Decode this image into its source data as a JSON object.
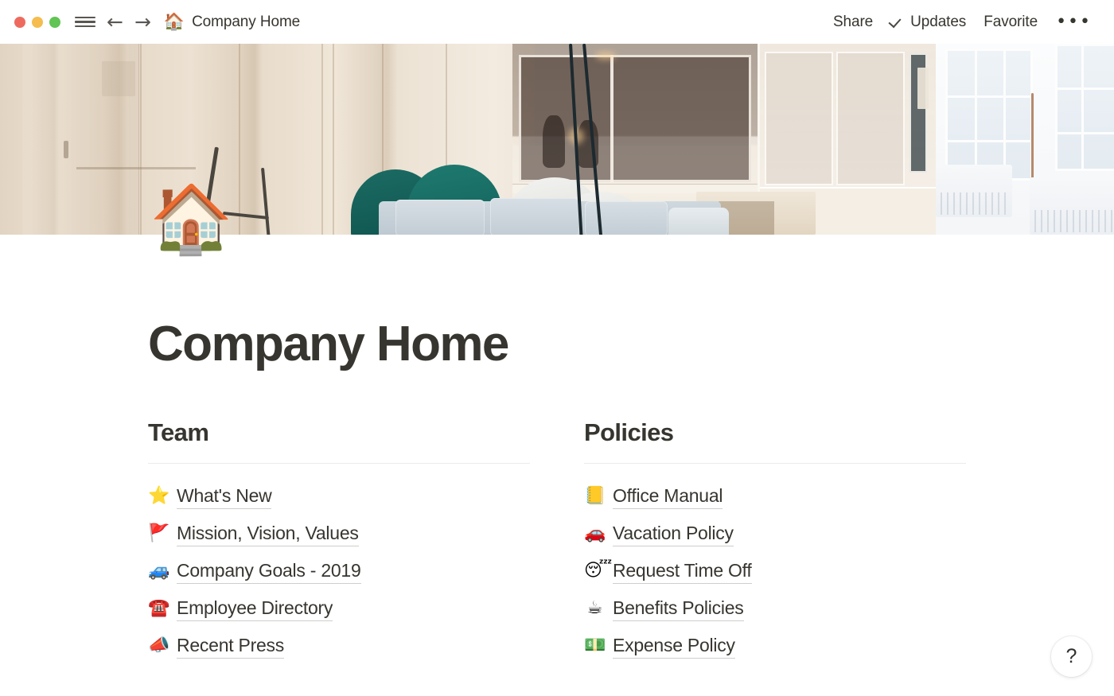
{
  "window": {
    "traffic_lights": [
      {
        "name": "close",
        "color": "#ee6a5f"
      },
      {
        "name": "minimize",
        "color": "#f5bd4f"
      },
      {
        "name": "zoom",
        "color": "#61c454"
      }
    ],
    "menu_icon": "hamburger-icon",
    "back_icon": "←",
    "forward_icon": "→",
    "breadcrumb_emoji": "🏠",
    "breadcrumb_title": "Company Home"
  },
  "toolbar": {
    "share_label": "Share",
    "updates_label": "Updates",
    "updates_check_icon": "check-icon",
    "favorite_label": "Favorite",
    "more_label": "•••"
  },
  "cover": {
    "alt": "bright modern office interior with wood panelling, glass partitions, teal chairs and a grey sofa"
  },
  "page": {
    "icon_emoji": "🏠",
    "title": "Company Home"
  },
  "columns": [
    {
      "heading": "Team",
      "links": [
        {
          "emoji": "⭐",
          "icon_name": "star-icon",
          "label": "What's New"
        },
        {
          "emoji": "🚩",
          "icon_name": "triangular-flag-icon",
          "label": "Mission, Vision, Values"
        },
        {
          "emoji": "🚙",
          "icon_name": "blue-car-icon",
          "label": "Company Goals - 2019"
        },
        {
          "emoji": "☎️",
          "icon_name": "telephone-icon",
          "label": "Employee Directory"
        },
        {
          "emoji": "📣",
          "icon_name": "megaphone-icon",
          "label": "Recent Press"
        }
      ]
    },
    {
      "heading": "Policies",
      "links": [
        {
          "emoji": "📒",
          "icon_name": "notebook-icon",
          "label": "Office Manual"
        },
        {
          "emoji": "🚗",
          "icon_name": "red-car-icon",
          "label": "Vacation Policy"
        },
        {
          "emoji": "😴",
          "icon_name": "sleeping-face-icon",
          "label": "Request Time Off"
        },
        {
          "emoji": "☕",
          "icon_name": "coffee-icon",
          "label": "Benefits Policies"
        },
        {
          "emoji": "💵",
          "icon_name": "banknote-icon",
          "label": "Expense Policy"
        }
      ]
    }
  ],
  "help": {
    "label": "?"
  },
  "colors": {
    "text": "#37352f",
    "rule": "#ebebea",
    "underline": "#cfcecb",
    "background": "#ffffff"
  }
}
